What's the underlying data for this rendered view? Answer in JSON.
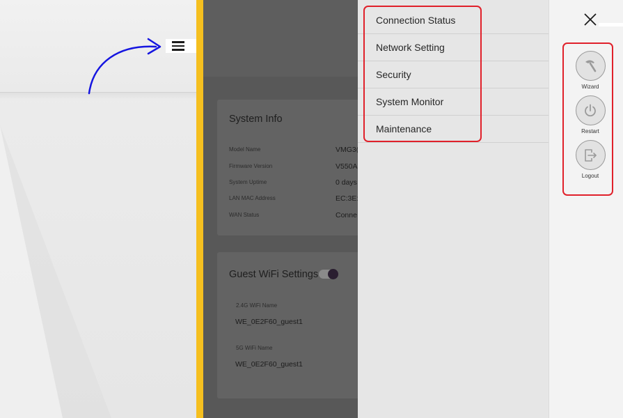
{
  "menu": {
    "items": [
      {
        "id": "connection-status",
        "label": "Connection Status"
      },
      {
        "id": "network-setting",
        "label": "Network Setting"
      },
      {
        "id": "security",
        "label": "Security"
      },
      {
        "id": "system-monitor",
        "label": "System Monitor"
      },
      {
        "id": "maintenance",
        "label": "Maintenance"
      }
    ]
  },
  "actions": {
    "wizard": {
      "label": "Wizard",
      "icon": "wizard-wand-icon"
    },
    "restart": {
      "label": "Restart",
      "icon": "power-icon"
    },
    "logout": {
      "label": "Logout",
      "icon": "logout-icon"
    }
  },
  "dashboard": {
    "system_info": {
      "title": "System Info",
      "rows": [
        {
          "label": "Model Name",
          "value": "VMG3("
        },
        {
          "label": "Firmware Version",
          "value": "V550A"
        },
        {
          "label": "System Uptime",
          "value": "0 days"
        },
        {
          "label": "LAN MAC Address",
          "value": "EC:3E:"
        },
        {
          "label": "WAN Status",
          "value": "Conne"
        }
      ]
    },
    "guest_wifi": {
      "title": "Guest WiFi Settings",
      "band_24_label": "2.4G WiFi Name",
      "band_24_value": "WE_0E2F60_guest1",
      "band_5_label": "5G WiFi Name",
      "band_5_value": "WE_0E2F60_guest1"
    }
  },
  "colors": {
    "highlight": "#e0202a",
    "divider": "#f5bf1f",
    "arrow": "#1515e0"
  }
}
